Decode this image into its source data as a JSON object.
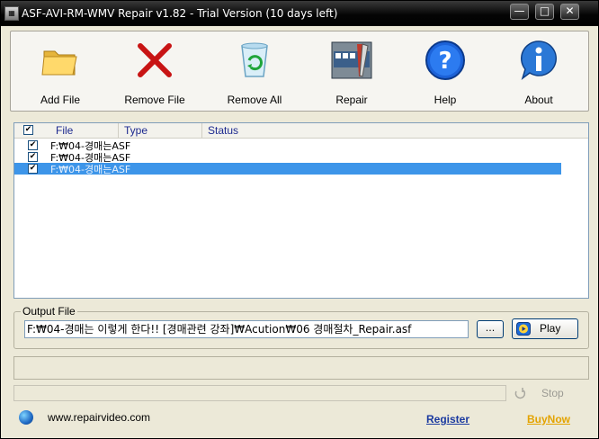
{
  "window": {
    "title": "ASF-AVI-RM-WMV Repair v1.82 - Trial Version (10 days left)",
    "controls": {
      "minimize": "—",
      "maximize": "□",
      "close": "✕"
    }
  },
  "toolbar": {
    "items": [
      {
        "label": "Add File",
        "icon": "folder-icon"
      },
      {
        "label": "Remove File",
        "icon": "red-x-icon"
      },
      {
        "label": "Remove All",
        "icon": "recycle-bin-icon"
      },
      {
        "label": "Repair",
        "icon": "repair-tools-icon"
      },
      {
        "label": "Help",
        "icon": "question-icon"
      },
      {
        "label": "About",
        "icon": "info-icon"
      }
    ]
  },
  "file_list": {
    "columns": [
      "File",
      "Type",
      "Status"
    ],
    "header_checked": true,
    "rows": [
      {
        "name": "F:₩04-경매는ASF",
        "checked": true,
        "selected": false
      },
      {
        "name": "F:₩04-경매는ASF",
        "checked": true,
        "selected": false
      },
      {
        "name": "F:₩04-경매는ASF",
        "checked": true,
        "selected": true
      }
    ]
  },
  "output": {
    "legend": "Output File",
    "value": "F:₩04-경매는 이렇게 한다!! [경매관련 강좌]₩Acution₩06 경매절차_Repair.asf",
    "browse_label": "...",
    "play_label": "Play"
  },
  "progress": {
    "value": 0
  },
  "stop": {
    "label": "Stop"
  },
  "footer": {
    "website": "www.repairvideo.com",
    "register": "Register",
    "buy_now": "BuyNow"
  },
  "colors": {
    "selection": "#3d95e9",
    "register": "#1b3aa0",
    "buy_now": "#e3a300"
  }
}
